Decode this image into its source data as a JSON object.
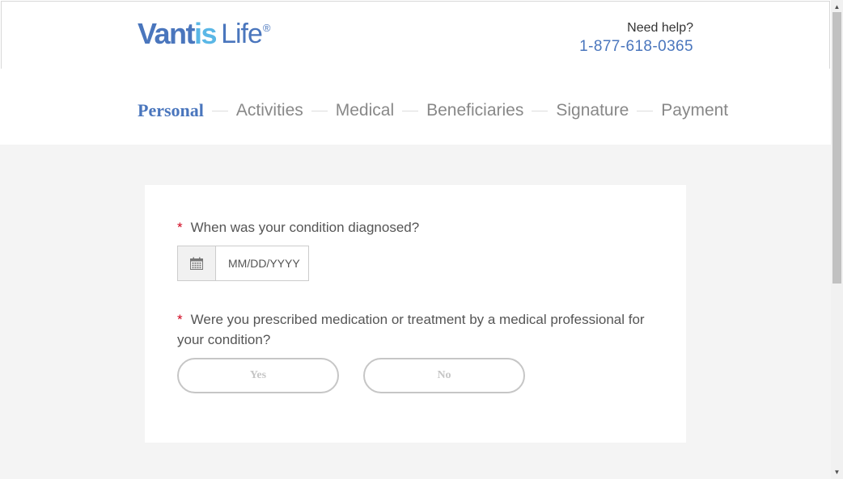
{
  "header": {
    "logo": {
      "part1": "Vant",
      "part2": "is",
      "part3": "Life",
      "mark": "®"
    },
    "help": {
      "label": "Need help?",
      "phone": "1-877-618-0365"
    }
  },
  "steps": [
    {
      "label": "Personal",
      "active": true
    },
    {
      "label": "Activities",
      "active": false
    },
    {
      "label": "Medical",
      "active": false
    },
    {
      "label": "Beneficiaries",
      "active": false
    },
    {
      "label": "Signature",
      "active": false
    },
    {
      "label": "Payment",
      "active": false
    }
  ],
  "form": {
    "required_mark": "*",
    "q1": {
      "text": "When was your condition diagnosed?"
    },
    "date": {
      "placeholder": "MM/DD/YYYY",
      "value": "",
      "icon": "calendar-icon"
    },
    "q2": {
      "text": "Were you prescribed medication or treatment by a medical professional for your condition?"
    },
    "yes_label": "Yes",
    "no_label": "No"
  },
  "colors": {
    "brand": "#4a76bd",
    "brand_light": "#5ab7e6",
    "required": "#d0021b",
    "page_bg": "#f4f4f4"
  }
}
